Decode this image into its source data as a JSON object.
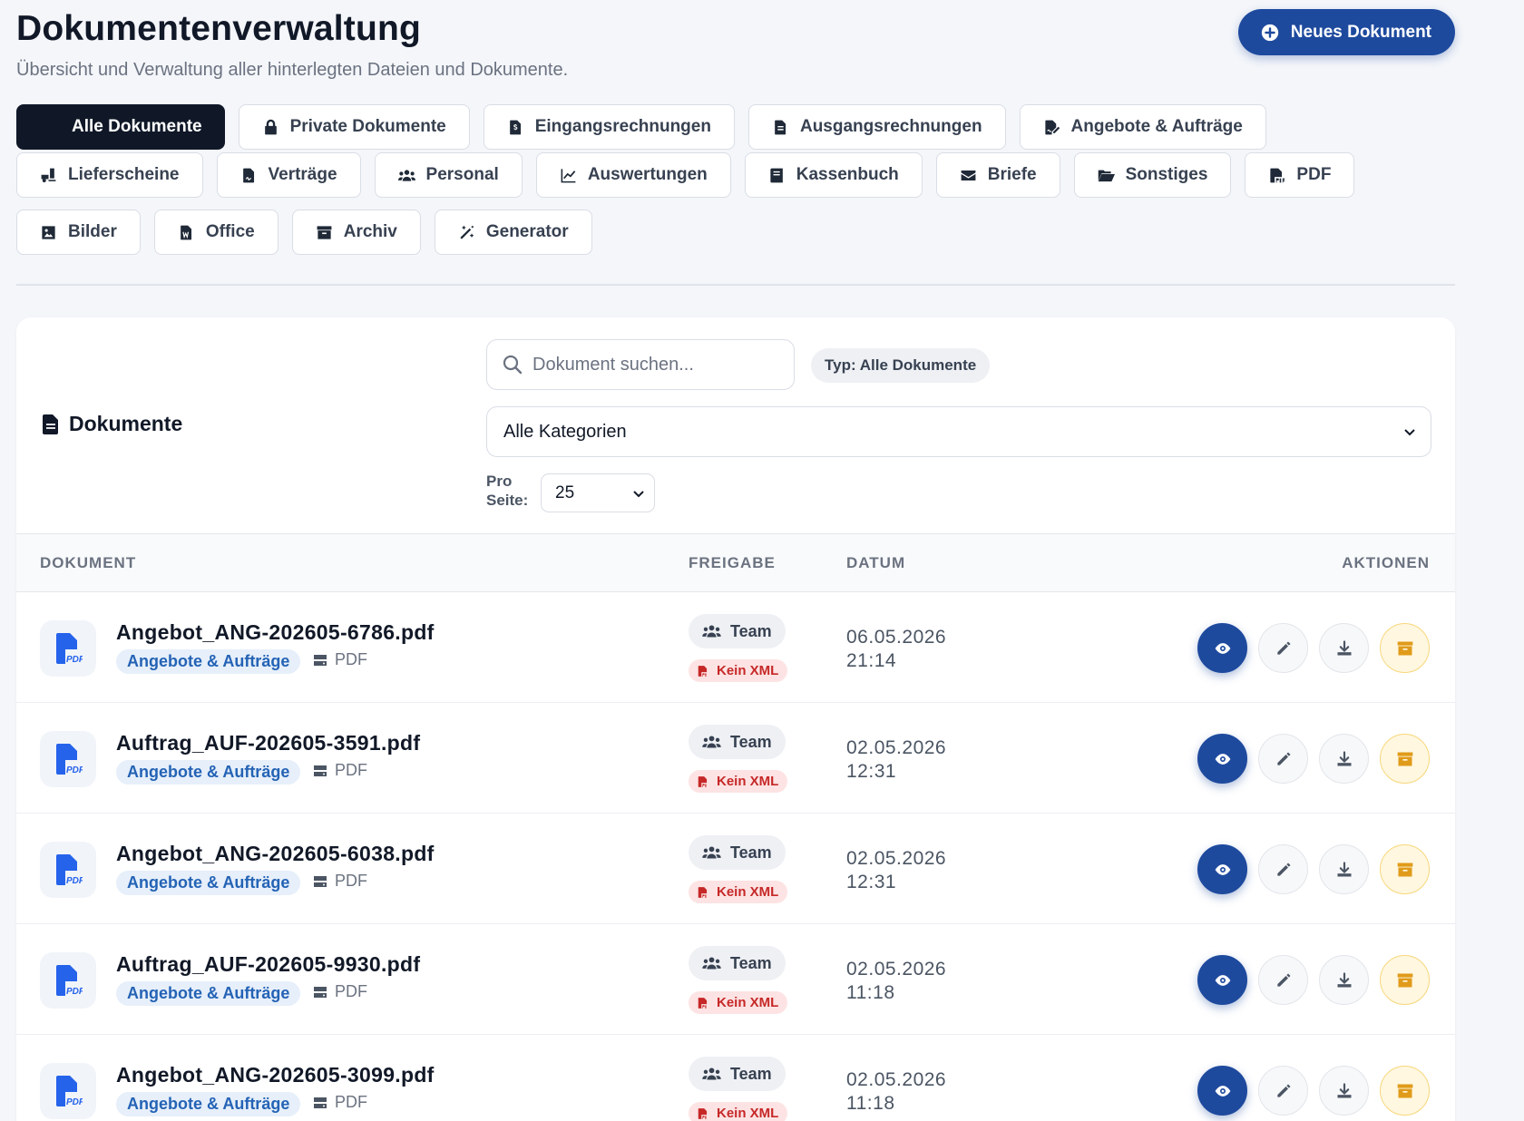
{
  "header": {
    "title": "Dokumentenverwaltung",
    "subtitle": "Übersicht und Verwaltung aller hinterlegten Dateien und Dokumente.",
    "new_button": "Neues Dokument"
  },
  "categories": [
    {
      "label": "Alle Dokumente",
      "icon": "none",
      "active": true
    },
    {
      "label": "Private Dokumente",
      "icon": "lock-icon"
    },
    {
      "label": "Eingangsrechnungen",
      "icon": "invoice-dollar-icon"
    },
    {
      "label": "Ausgangsrechnungen",
      "icon": "invoice-icon"
    },
    {
      "label": "Angebote & Aufträge",
      "icon": "file-signature-icon"
    },
    {
      "label": "Lieferscheine",
      "icon": "truck-loading-icon"
    },
    {
      "label": "Verträge",
      "icon": "contract-icon"
    },
    {
      "label": "Personal",
      "icon": "users-icon"
    },
    {
      "label": "Auswertungen",
      "icon": "chart-line-icon"
    },
    {
      "label": "Kassenbuch",
      "icon": "book-icon"
    },
    {
      "label": "Briefe",
      "icon": "envelope-icon"
    },
    {
      "label": "Sonstiges",
      "icon": "folder-open-icon"
    },
    {
      "label": "PDF",
      "icon": "file-pdf-icon"
    },
    {
      "label": "Bilder",
      "icon": "image-icon"
    },
    {
      "label": "Office",
      "icon": "file-word-icon"
    },
    {
      "label": "Archiv",
      "icon": "archive-icon"
    },
    {
      "label": "Generator",
      "icon": "magic-wand-icon"
    }
  ],
  "card": {
    "title": "Dokumente",
    "search_placeholder": "Dokument suchen...",
    "type_filter": "Typ: Alle Dokumente",
    "category_select": "Alle Kategorien",
    "per_page_label": "Pro Seite:",
    "per_page_value": "25"
  },
  "table": {
    "headers": {
      "document": "DOKUMENT",
      "share": "FREIGABE",
      "date": "DATUM",
      "actions": "AKTIONEN"
    },
    "rows": [
      {
        "name": "Angebot_ANG-202605-6786.pdf",
        "category": "Angebote & Aufträge",
        "type": "PDF",
        "share": "Team",
        "xml": "Kein XML",
        "date": "06.05.2026",
        "time": "21:14"
      },
      {
        "name": "Auftrag_AUF-202605-3591.pdf",
        "category": "Angebote & Aufträge",
        "type": "PDF",
        "share": "Team",
        "xml": "Kein XML",
        "date": "02.05.2026",
        "time": "12:31"
      },
      {
        "name": "Angebot_ANG-202605-6038.pdf",
        "category": "Angebote & Aufträge",
        "type": "PDF",
        "share": "Team",
        "xml": "Kein XML",
        "date": "02.05.2026",
        "time": "12:31"
      },
      {
        "name": "Auftrag_AUF-202605-9930.pdf",
        "category": "Angebote & Aufträge",
        "type": "PDF",
        "share": "Team",
        "xml": "Kein XML",
        "date": "02.05.2026",
        "time": "11:18"
      },
      {
        "name": "Angebot_ANG-202605-3099.pdf",
        "category": "Angebote & Aufträge",
        "type": "PDF",
        "share": "Team",
        "xml": "Kein XML",
        "date": "02.05.2026",
        "time": "11:18"
      }
    ]
  },
  "colors": {
    "primary": "#1e4a9e",
    "dark": "#101828",
    "badge_blue": "#2463b5",
    "xml_red": "#c62828",
    "archive_amber": "#e09b1a"
  }
}
